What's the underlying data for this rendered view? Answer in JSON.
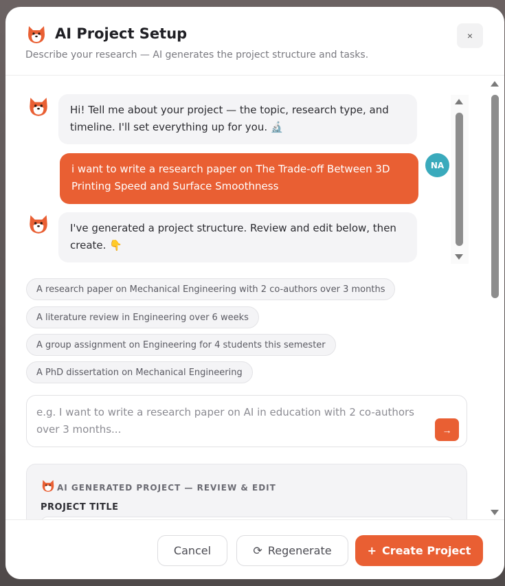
{
  "header": {
    "title": "AI Project Setup",
    "subtitle": "Describe your research — AI generates the project structure and tasks.",
    "close_label": "×"
  },
  "chat": {
    "messages": [
      {
        "role": "bot",
        "text": "Hi! Tell me about your project — the topic, research type, and timeline. I'll set everything up for you. 🔬"
      },
      {
        "role": "user",
        "text": "i want to write a research paper on The Trade-off Between 3D Printing Speed and Surface Smoothness",
        "avatar_initials": "NA"
      },
      {
        "role": "bot",
        "text": "I've generated a project structure. Review and edit below, then create. 👇"
      }
    ]
  },
  "suggestions": [
    "A research paper on Mechanical Engineering with 2 co-authors over 3 months",
    "A literature review in Engineering over 6 weeks",
    "A group assignment on Engineering for 4 students this semester",
    "A PhD dissertation on Mechanical Engineering"
  ],
  "prompt": {
    "placeholder": "e.g. I want to write a research paper on AI in education with 2 co-authors over 3 months...",
    "value": "",
    "send_icon": "→"
  },
  "generated": {
    "header": "AI GENERATED PROJECT — REVIEW & EDIT",
    "project_title_label": "PROJECT TITLE"
  },
  "footer": {
    "cancel_label": "Cancel",
    "regenerate_icon": "⟳",
    "regenerate_label": "Regenerate",
    "create_icon": "+",
    "create_label": "Create Project"
  },
  "colors": {
    "accent": "#e95f33",
    "user_avatar": "#3aaabc"
  }
}
